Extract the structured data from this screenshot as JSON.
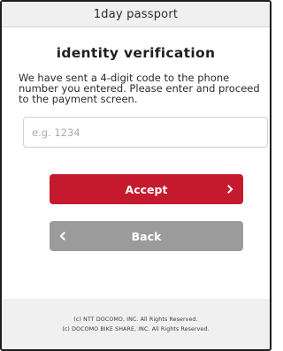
{
  "header": {
    "title": "1day passport"
  },
  "main": {
    "title": "identity verification",
    "instructions": "We have sent a 4-digit code to the phone number you entered. Please enter and proceed to the payment screen.",
    "code_input": {
      "value": "",
      "placeholder": "e.g. 1234"
    },
    "accept_label": "Accept",
    "back_label": "Back"
  },
  "footer": {
    "line1": "(c) NTT DOCOMO, INC. All Rights Reserved.",
    "line2": "(c) DOCOMO BIKE SHARE, INC. All Rights Reserved."
  },
  "colors": {
    "accept_button": "#c51a2e",
    "back_button": "#9b9b9b",
    "header_background": "#f0f0f0",
    "footer_background": "#f0f0f0"
  },
  "icons": {
    "accept": "chevron-right-icon",
    "back": "chevron-left-icon"
  }
}
